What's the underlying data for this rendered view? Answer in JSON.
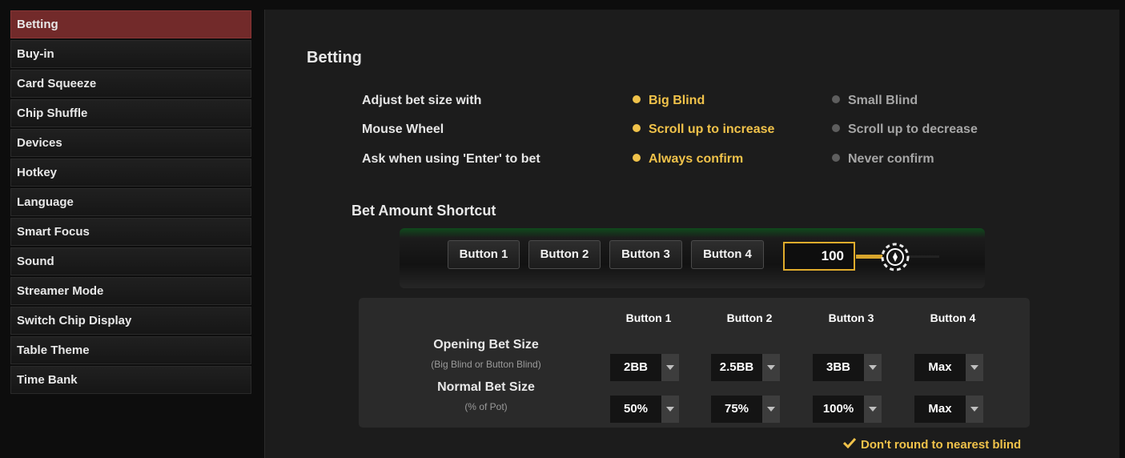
{
  "sidebar": {
    "items": [
      {
        "label": "Betting",
        "active": true
      },
      {
        "label": "Buy-in"
      },
      {
        "label": "Card Squeeze"
      },
      {
        "label": "Chip Shuffle"
      },
      {
        "label": "Devices"
      },
      {
        "label": "Hotkey"
      },
      {
        "label": "Language"
      },
      {
        "label": "Smart Focus"
      },
      {
        "label": "Sound"
      },
      {
        "label": "Streamer Mode"
      },
      {
        "label": "Switch Chip Display"
      },
      {
        "label": "Table Theme"
      },
      {
        "label": "Time Bank"
      }
    ]
  },
  "main": {
    "title": "Betting",
    "options": [
      {
        "label": "Adjust bet size with",
        "selected": "Big Blind",
        "alternative": "Small Blind"
      },
      {
        "label": "Mouse Wheel",
        "selected": "Scroll up to increase",
        "alternative": "Scroll up to decrease"
      },
      {
        "label": "Ask when using 'Enter' to bet",
        "selected": "Always confirm",
        "alternative": "Never confirm"
      }
    ],
    "shortcut": {
      "title": "Bet Amount Shortcut",
      "buttons": [
        "Button 1",
        "Button 2",
        "Button 3",
        "Button 4"
      ],
      "amount": "100"
    },
    "bet_sizes": {
      "columns": [
        "Button 1",
        "Button 2",
        "Button 3",
        "Button 4"
      ],
      "opening": {
        "title": "Opening Bet Size",
        "subtitle": "(Big Blind or Button Blind)",
        "values": [
          "2BB",
          "2.5BB",
          "3BB",
          "Max"
        ]
      },
      "normal": {
        "title": "Normal Bet Size",
        "subtitle": "(% of Pot)",
        "values": [
          "50%",
          "75%",
          "100%",
          "Max"
        ]
      }
    },
    "round_option": {
      "label": "Don't round to nearest blind",
      "checked": true
    }
  },
  "colors": {
    "accent": "#f0c24a",
    "active_tab": "#722a2a",
    "amount_border": "#e0ac2c"
  }
}
